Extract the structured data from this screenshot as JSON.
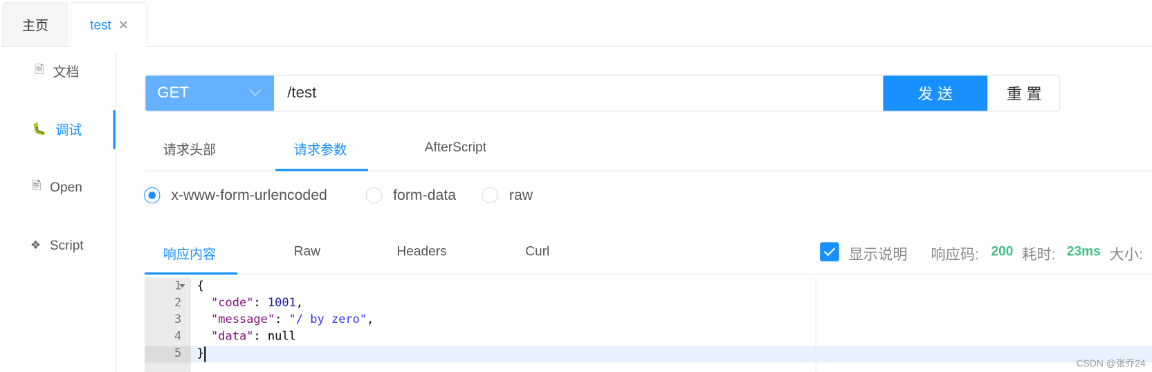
{
  "tabs": [
    {
      "label": "主页"
    },
    {
      "label": "test",
      "close": "×"
    }
  ],
  "sidebar": {
    "items": [
      {
        "label": "文档",
        "icon": "document-icon"
      },
      {
        "label": "调试",
        "icon": "bug-icon",
        "active": true
      },
      {
        "label": "Open",
        "icon": "file-icon"
      },
      {
        "label": "Script",
        "icon": "codepen-icon"
      }
    ]
  },
  "request": {
    "method": "GET",
    "url": "/test",
    "send": "发 送",
    "reset": "重 置"
  },
  "request_tabs": [
    {
      "label": "请求头部"
    },
    {
      "label": "请求参数",
      "active": true
    },
    {
      "label": "AfterScript"
    }
  ],
  "body_types": [
    {
      "label": "x-www-form-urlencoded",
      "checked": true
    },
    {
      "label": "form-data"
    },
    {
      "label": "raw"
    }
  ],
  "response_tabs": [
    {
      "label": "响应内容",
      "active": true
    },
    {
      "label": "Raw"
    },
    {
      "label": "Headers"
    },
    {
      "label": "Curl"
    }
  ],
  "response_meta": {
    "show_desc": "显示说明",
    "show_desc_checked": true,
    "code_label": "响应码:",
    "code": "200",
    "time_label": "耗时:",
    "time": "23ms",
    "size_label": "大小:"
  },
  "editor": {
    "line_numbers": [
      "1",
      "2",
      "3",
      "4",
      "5"
    ],
    "lines": [
      [
        {
          "t": "{",
          "c": ""
        }
      ],
      [
        {
          "t": "  ",
          "c": ""
        },
        {
          "t": "\"code\"",
          "c": "k"
        },
        {
          "t": ": ",
          "c": ""
        },
        {
          "t": "1001",
          "c": "n"
        },
        {
          "t": ",",
          "c": ""
        }
      ],
      [
        {
          "t": "  ",
          "c": ""
        },
        {
          "t": "\"message\"",
          "c": "k"
        },
        {
          "t": ": ",
          "c": ""
        },
        {
          "t": "\"/ by zero\"",
          "c": "s"
        },
        {
          "t": ",",
          "c": ""
        }
      ],
      [
        {
          "t": "  ",
          "c": ""
        },
        {
          "t": "\"data\"",
          "c": "k"
        },
        {
          "t": ": null",
          "c": ""
        }
      ],
      [
        {
          "t": "}",
          "c": ""
        }
      ]
    ]
  },
  "watermark": "CSDN @张乔24",
  "colors": {
    "accent": "#1890ff",
    "method_bg": "#66b1ff",
    "success": "#3fbf86"
  }
}
